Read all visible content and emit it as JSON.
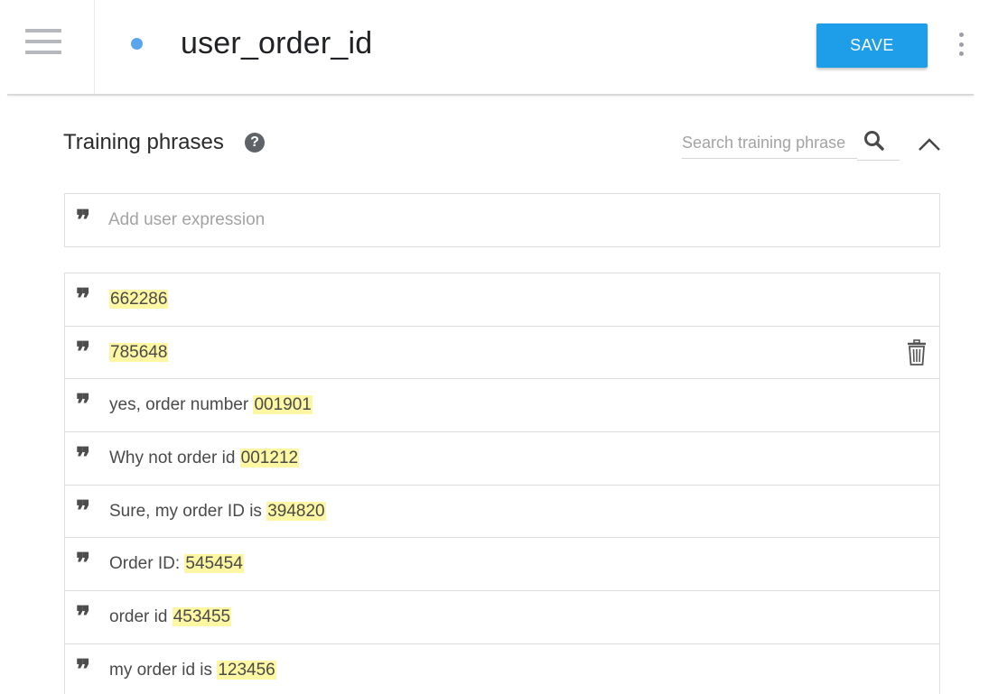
{
  "header": {
    "menu_icon": "hamburger-menu-icon",
    "intent_name": "user_order_id",
    "status_color": "#5aa6ec",
    "save_label": "SAVE",
    "save_color": "#1e9ee9",
    "more_icon": "more-vert-icon"
  },
  "training": {
    "title": "Training phrases",
    "help_icon": "help-icon",
    "search_placeholder": "Search training phrase",
    "search_icon": "search-icon",
    "collapse_icon": "chevron-up-icon",
    "add_placeholder": "Add user expression",
    "quote_glyph": "”",
    "highlight_color": "#fdf6a3",
    "phrases": [
      {
        "prefix": "",
        "entity": "662286"
      },
      {
        "prefix": "",
        "entity": "785648"
      },
      {
        "prefix": "yes, order number ",
        "entity": "001901"
      },
      {
        "prefix": "Why not order id ",
        "entity": "001212"
      },
      {
        "prefix": "Sure, my order ID is ",
        "entity": "394820"
      },
      {
        "prefix": "Order ID: ",
        "entity": "545454"
      },
      {
        "prefix": "order id ",
        "entity": "453455"
      },
      {
        "prefix": "my order id is ",
        "entity": "123456"
      }
    ],
    "delete_icon": "trash-icon"
  }
}
